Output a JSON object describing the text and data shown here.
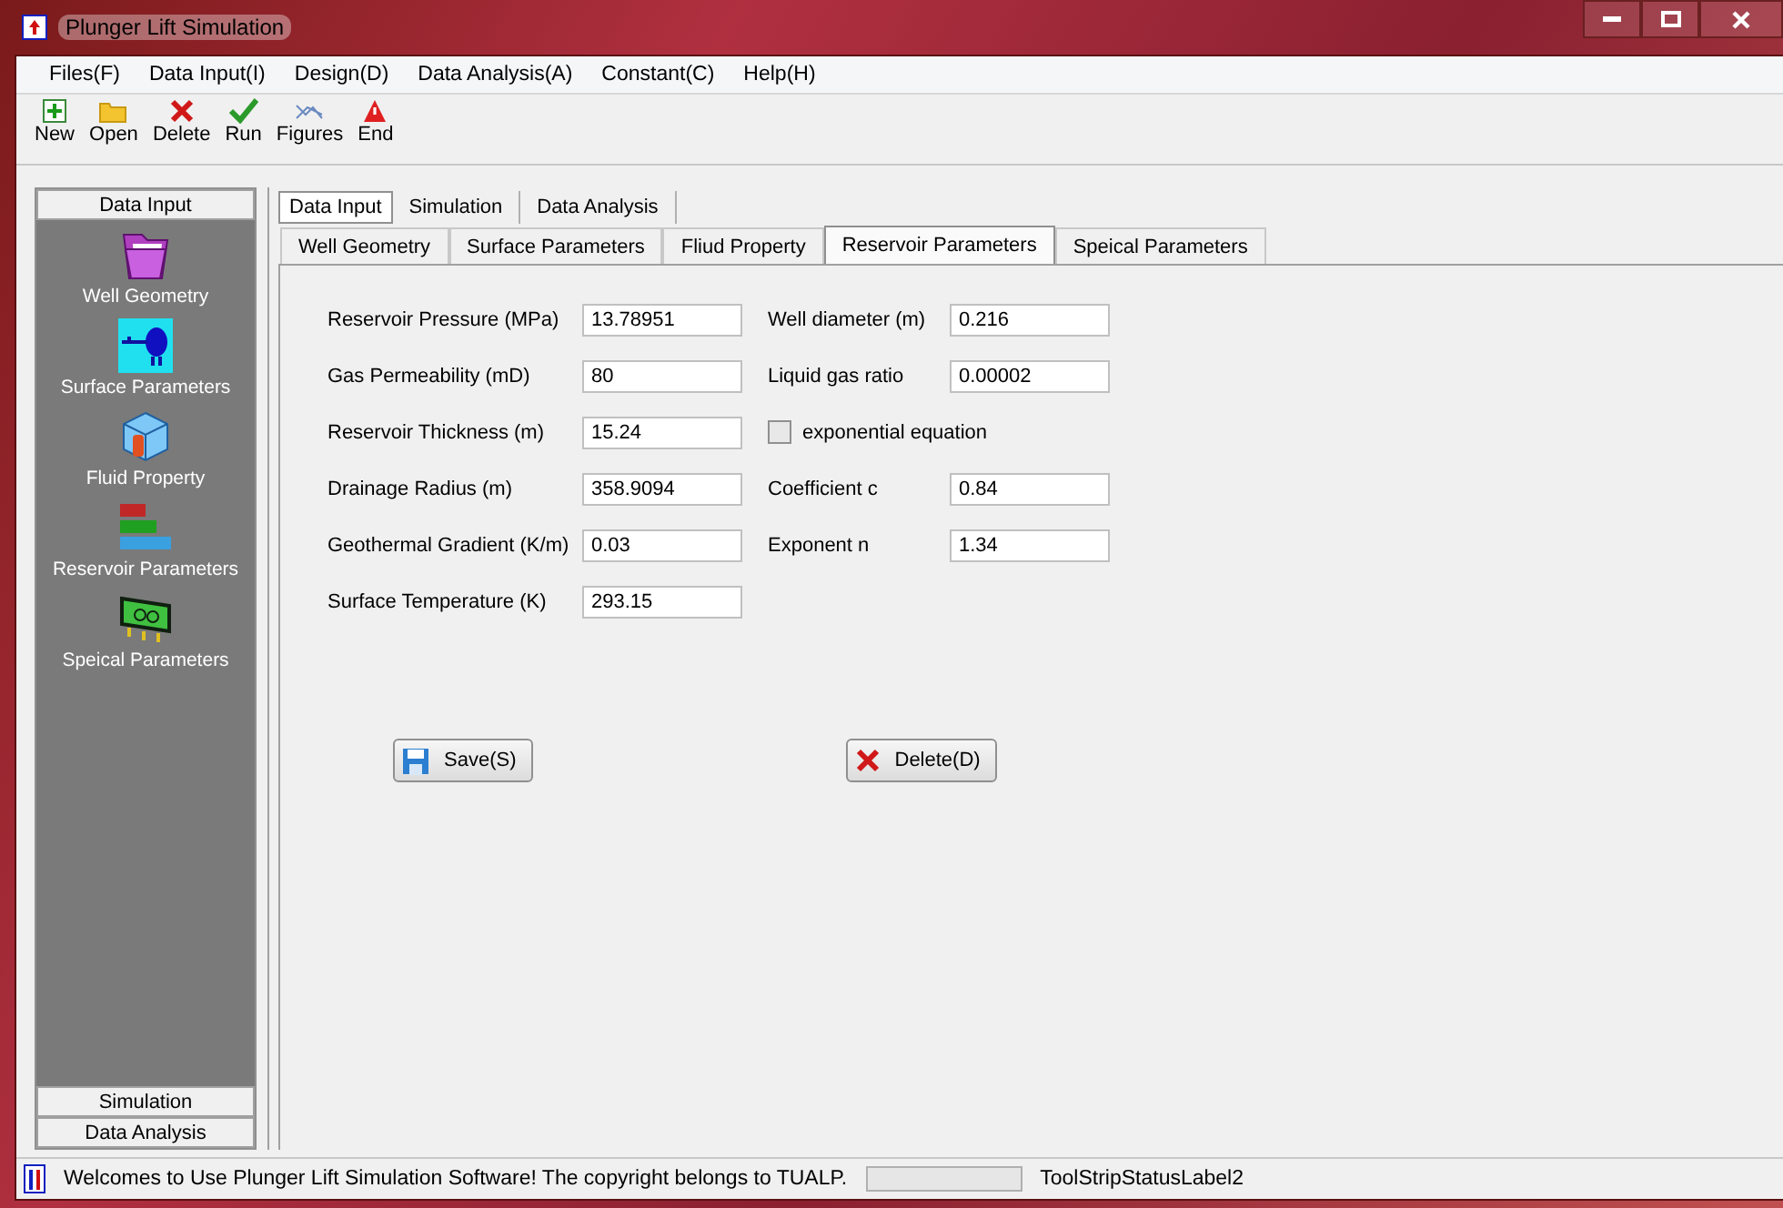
{
  "window": {
    "title": "Plunger Lift Simulation"
  },
  "menu": [
    "Files(F)",
    "Data Input(I)",
    "Design(D)",
    "Data Analysis(A)",
    "Constant(C)",
    "Help(H)"
  ],
  "toolbar": [
    {
      "kind": "new",
      "label": "New"
    },
    {
      "kind": "open",
      "label": "Open"
    },
    {
      "kind": "delete",
      "label": "Delete"
    },
    {
      "kind": "run",
      "label": "Run"
    },
    {
      "kind": "figures",
      "label": "Figures"
    },
    {
      "kind": "end",
      "label": "End"
    }
  ],
  "sidebar": {
    "sections": [
      {
        "label": "Data Input",
        "items": [
          {
            "kind": "folder",
            "label": "Well Geometry"
          },
          {
            "kind": "tank",
            "label": "Surface Parameters"
          },
          {
            "kind": "cube",
            "label": "Fluid Property"
          },
          {
            "kind": "bars",
            "label": "Reservoir Parameters"
          },
          {
            "kind": "board",
            "label": "Speical Parameters"
          }
        ]
      },
      {
        "label": "Simulation"
      },
      {
        "label": "Data  Analysis"
      }
    ]
  },
  "tabs": [
    {
      "label": "Data Input",
      "selected": true
    },
    {
      "label": "Simulation",
      "selected": false
    },
    {
      "label": "Data Analysis",
      "selected": false
    }
  ],
  "subtabs": [
    {
      "label": "Well Geometry",
      "selected": false
    },
    {
      "label": "Surface Parameters",
      "selected": false
    },
    {
      "label": "Fliud Property",
      "selected": false
    },
    {
      "label": "Reservoir Parameters",
      "selected": true
    },
    {
      "label": "Speical Parameters",
      "selected": false
    }
  ],
  "form": {
    "left": [
      {
        "kind": "field",
        "label": "Reservoir Pressure (MPa)",
        "value": "13.78951"
      },
      {
        "kind": "field",
        "label": "Gas Permeability (mD)",
        "value": "80"
      },
      {
        "kind": "field",
        "label": "Reservoir Thickness (m)",
        "value": "15.24"
      },
      {
        "kind": "field",
        "label": "Drainage Radius (m)",
        "value": "358.9094"
      },
      {
        "kind": "field",
        "label": "Geothermal Gradient (K/m)",
        "value": "0.03"
      },
      {
        "kind": "field",
        "label": "Surface Temperature (K)",
        "value": "293.15"
      }
    ],
    "right": [
      {
        "kind": "field",
        "label": "Well diameter (m)",
        "value": "0.216"
      },
      {
        "kind": "field",
        "label": "Liquid gas ratio",
        "value": "0.00002"
      },
      {
        "kind": "checkbox",
        "label": "exponential equation",
        "checked": false
      },
      {
        "kind": "field",
        "label": "Coefficient c",
        "value": "0.84"
      },
      {
        "kind": "field",
        "label": "Exponent  n",
        "value": "1.34"
      }
    ]
  },
  "buttons": [
    {
      "kind": "save",
      "label": "Save(S)"
    },
    {
      "kind": "delete",
      "label": "Delete(D)"
    }
  ],
  "status_bar": {
    "message": "Welcomes to Use Plunger Lift Simulation Software! The copyright belongs to TUALP.",
    "label": "ToolStripStatusLabel2"
  }
}
